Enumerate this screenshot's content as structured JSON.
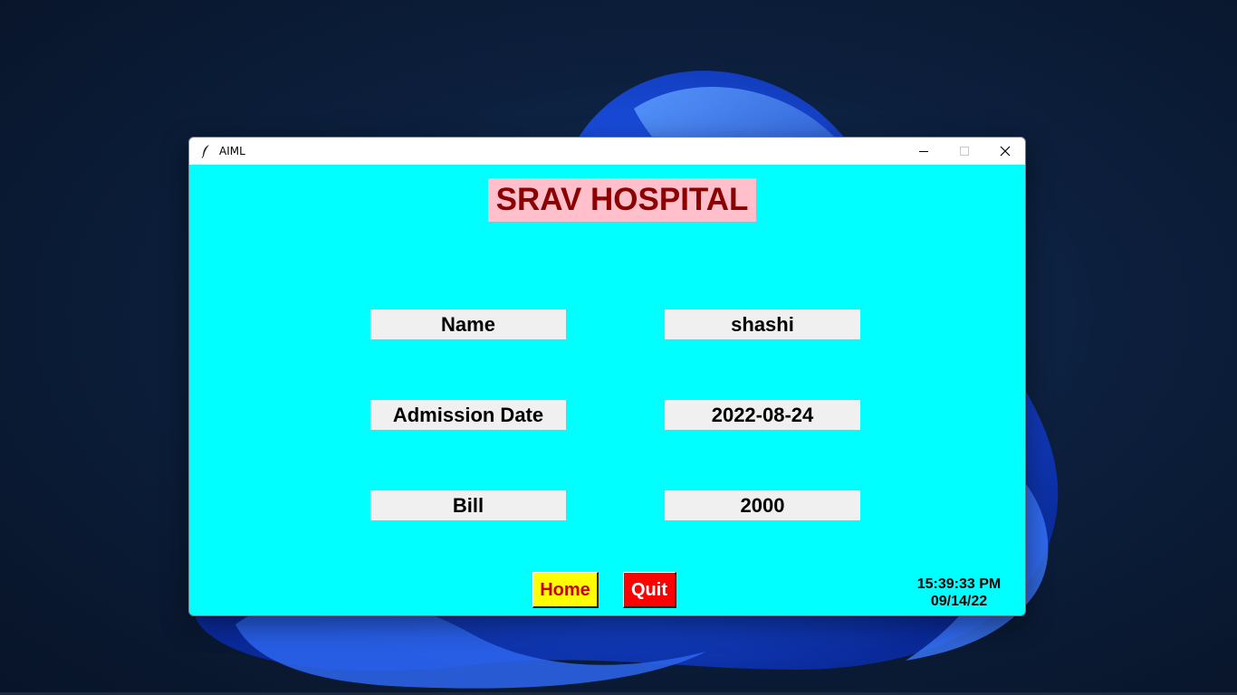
{
  "window": {
    "title": "AIML",
    "controls": {
      "minimize": "minimize-icon",
      "maximize": "maximize-icon",
      "close": "close-icon"
    }
  },
  "colors": {
    "background": "#00ffff",
    "title_bg": "#ffc0cb",
    "title_fg": "#8b0000",
    "field_bg": "#f0f0f0",
    "home_bg": "#ffff00",
    "home_fg": "#cc0000",
    "quit_bg": "#ff0000",
    "quit_fg": "#ffffff"
  },
  "header": {
    "title": "SRAV HOSPITAL"
  },
  "fields": [
    {
      "label": "Name",
      "value": "shashi"
    },
    {
      "label": "Admission Date",
      "value": "2022-08-24"
    },
    {
      "label": "Bill",
      "value": "2000"
    }
  ],
  "buttons": {
    "home": "Home",
    "quit": "Quit"
  },
  "clock": {
    "time": "15:39:33 PM",
    "date": "09/14/22"
  }
}
